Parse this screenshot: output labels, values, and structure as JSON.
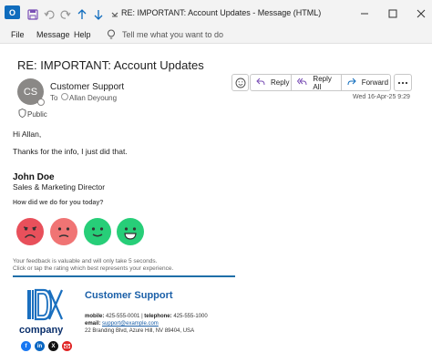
{
  "window": {
    "title": "RE: IMPORTANT: Account Updates  -  Message (HTML)",
    "app_badge": "O"
  },
  "menu": {
    "file": "File",
    "message": "Message",
    "help": "Help",
    "tell_me": "Tell me what you want to do"
  },
  "email": {
    "subject": "RE: IMPORTANT: Account Updates",
    "avatar_initials": "CS",
    "sender": "Customer Support",
    "to_label": "To",
    "recipient": "Allan Deyoung",
    "sensitivity": "Public",
    "timestamp": "Wed 16-Apr-25 9:29"
  },
  "actions": {
    "reply": "Reply",
    "reply_all": "Reply All",
    "forward": "Forward"
  },
  "body": {
    "greeting": "Hi Allan,",
    "message": "Thanks for the info, I just did that.",
    "signature_name": "John Doe",
    "signature_title": "Sales & Marketing Director",
    "rating_prompt": "How did we do for you today?",
    "feedback_line1": "Your feedback is valuable and will only take 5 seconds.",
    "feedback_line2": "Click or tap the rating which best represents your experience."
  },
  "ratings": [
    {
      "name": "very-unhappy",
      "color": "#e8505b"
    },
    {
      "name": "unhappy",
      "color": "#f07474"
    },
    {
      "name": "happy",
      "color": "#27ce78"
    },
    {
      "name": "very-happy",
      "color": "#27ce78"
    }
  ],
  "signature_card": {
    "company": "company",
    "name": "Customer Support",
    "mobile_label": "mobile:",
    "mobile": "425-555-0001",
    "separator": "|",
    "telephone_label": "telephone:",
    "telephone": "425-555-1000",
    "email_label": "email:",
    "email": "support@example.com",
    "address": "22 Branding Blvd, Azure Hill, NV 89404, USA",
    "social": [
      "facebook-icon",
      "linkedin-icon",
      "x-icon",
      "mail-icon"
    ]
  },
  "colors": {
    "accent": "#0f6cbd",
    "brand_navy": "#0a2f6b",
    "divider": "#1f6fa8"
  }
}
